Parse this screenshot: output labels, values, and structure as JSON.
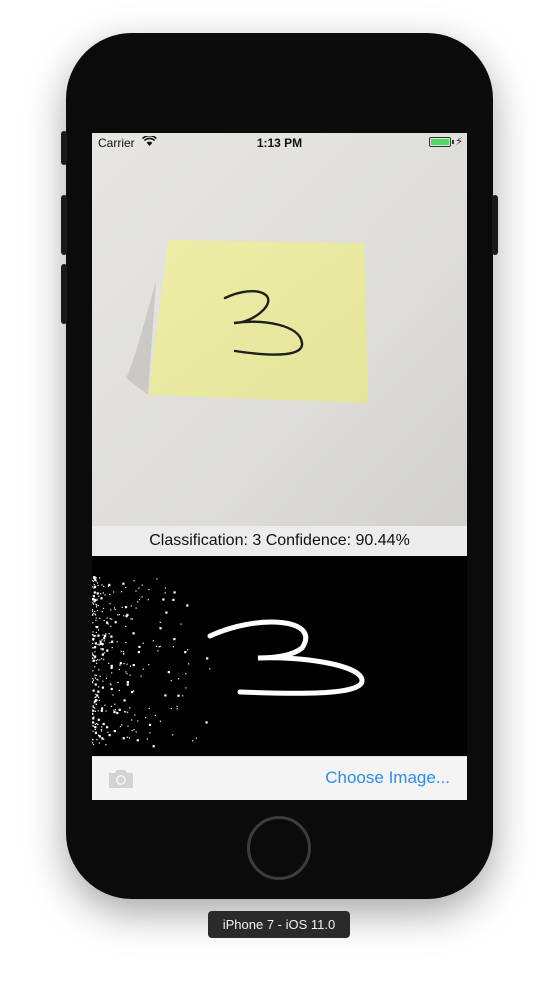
{
  "status_bar": {
    "carrier": "Carrier",
    "time": "1:13 PM"
  },
  "result": {
    "text": "Classification: 3 Confidence: 90.44%"
  },
  "toolbar": {
    "camera_icon": "camera-icon",
    "choose_image_label": "Choose Image..."
  },
  "simulator": {
    "device_label": "iPhone 7 - iOS 11.0"
  },
  "colors": {
    "accent": "#2b8ef0",
    "battery": "#4cd964",
    "note": "#ebeb9f"
  }
}
